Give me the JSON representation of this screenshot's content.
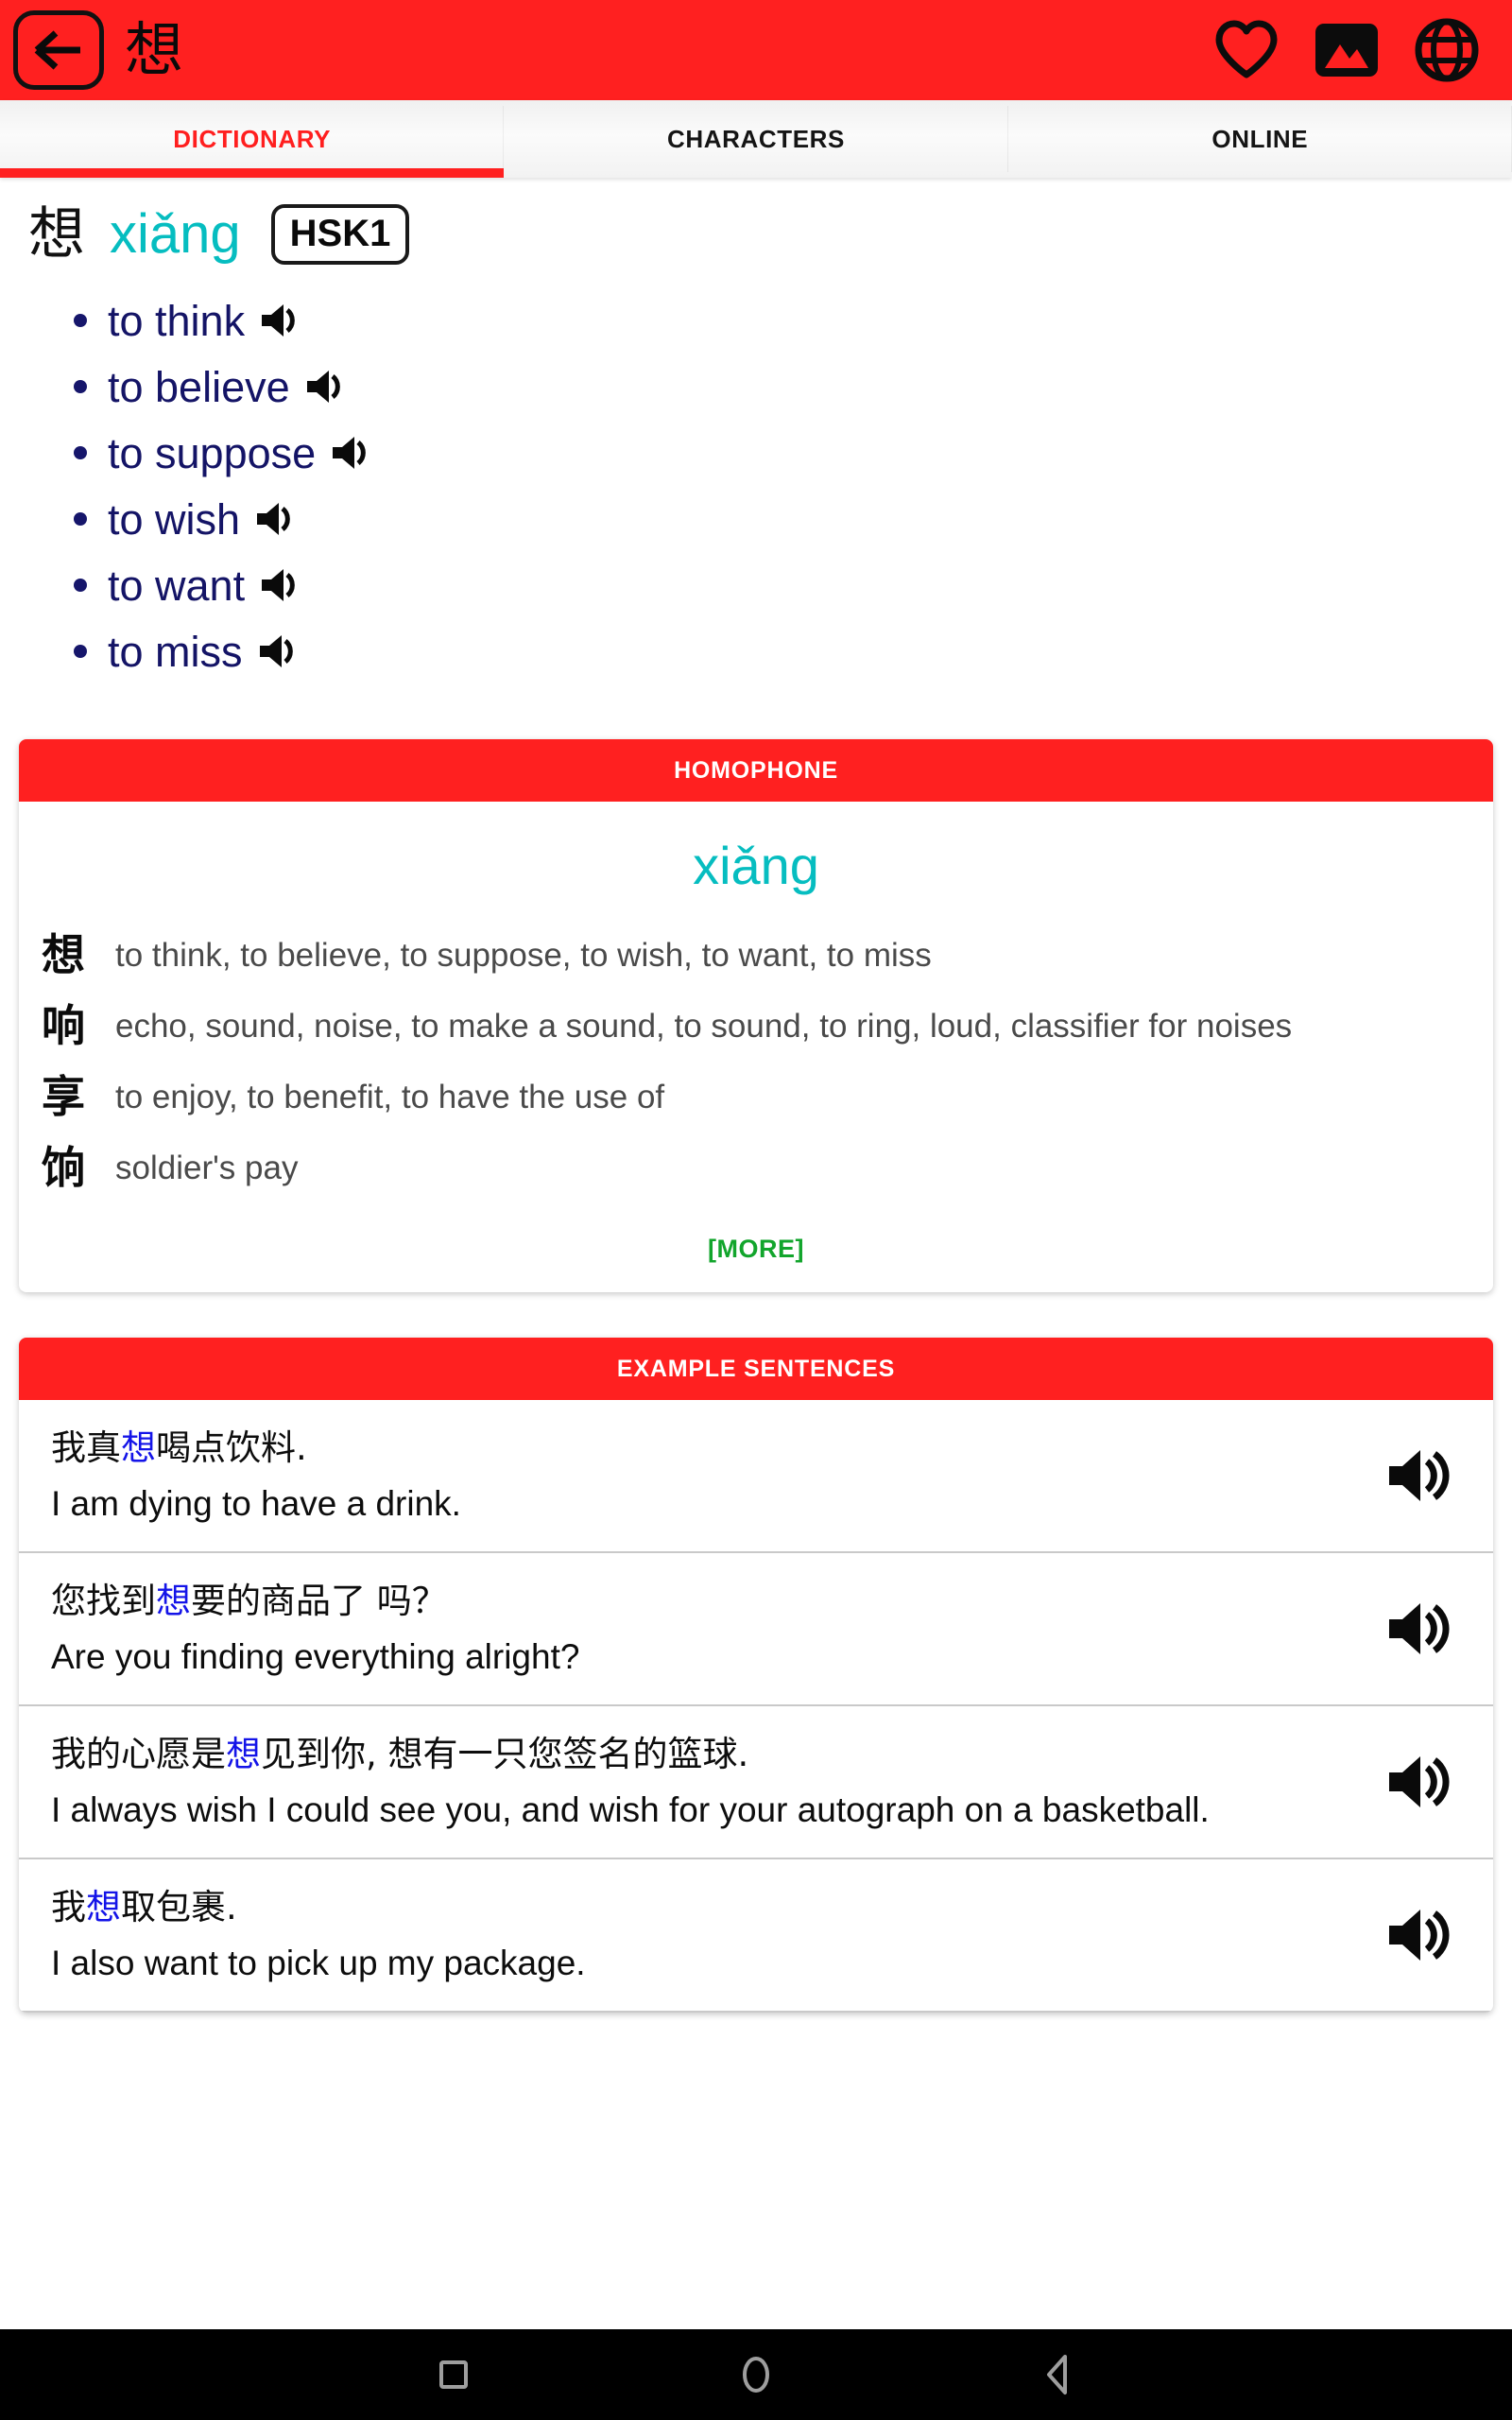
{
  "appbar": {
    "back_icon": "arrow-left-icon",
    "title": "想",
    "actions": [
      {
        "name": "favorite-icon",
        "label": "Favorite"
      },
      {
        "name": "image-icon",
        "label": "Image"
      },
      {
        "name": "globe-icon",
        "label": "Online"
      }
    ],
    "background_color": "#FF2020"
  },
  "tabs": {
    "items": [
      {
        "label": "DICTIONARY",
        "active": true
      },
      {
        "label": "CHARACTERS",
        "active": false
      },
      {
        "label": "ONLINE",
        "active": false
      }
    ],
    "active_color": "#FF1F1F",
    "inactive_color": "#151515"
  },
  "entry": {
    "character": "想",
    "pinyin": "xiǎng",
    "pinyin_color": "#06BDC0",
    "hsk_level": "HSK1",
    "definitions": [
      {
        "text": "to think",
        "audio": "speaker-icon"
      },
      {
        "text": "to believe",
        "audio": "speaker-icon"
      },
      {
        "text": "to suppose",
        "audio": "speaker-icon"
      },
      {
        "text": "to wish",
        "audio": "speaker-icon"
      },
      {
        "text": "to want",
        "audio": "speaker-icon"
      },
      {
        "text": "to miss",
        "audio": "speaker-icon"
      }
    ],
    "definition_color": "#141466"
  },
  "homophone": {
    "header": "HOMOPHONE",
    "pinyin": "xiǎng",
    "entries": [
      {
        "char": "想",
        "meaning": "to think, to believe, to suppose, to wish, to want, to miss"
      },
      {
        "char": "响",
        "meaning": "echo, sound, noise, to make a sound, to sound, to ring, loud, classifier for noises"
      },
      {
        "char": "享",
        "meaning": "to enjoy, to benefit, to have the use of"
      },
      {
        "char": "饷",
        "meaning": "soldier's pay"
      }
    ],
    "more_label": "[MORE]",
    "more_color": "#12A52C"
  },
  "examples": {
    "header": "EXAMPLE SENTENCES",
    "highlight_color": "#1414E8",
    "rows": [
      {
        "chinese_pre": "我真",
        "chinese_hl": "想",
        "chinese_post": "喝点饮料.",
        "english": "I am dying to have a drink.",
        "audio": "speaker-icon"
      },
      {
        "chinese_pre": "您找到",
        "chinese_hl": "想",
        "chinese_post": "要的商品了 吗？",
        "english": "Are you finding everything alright?",
        "audio": "speaker-icon"
      },
      {
        "chinese_pre": "我的心愿是",
        "chinese_hl": "想",
        "chinese_post": "见到你, 想有一只您签名的篮球.",
        "english": "I always wish I could see you, and wish for your autograph on a basketball.",
        "audio": "speaker-icon"
      },
      {
        "chinese_pre": "我",
        "chinese_hl": "想",
        "chinese_post": "取包裹.",
        "english": "I also want to pick up my package.",
        "audio": "speaker-icon"
      }
    ]
  },
  "navbar": {
    "buttons": [
      {
        "name": "recents-button",
        "label": "Recents"
      },
      {
        "name": "home-button",
        "label": "Home"
      },
      {
        "name": "back-button",
        "label": "Back"
      }
    ]
  }
}
